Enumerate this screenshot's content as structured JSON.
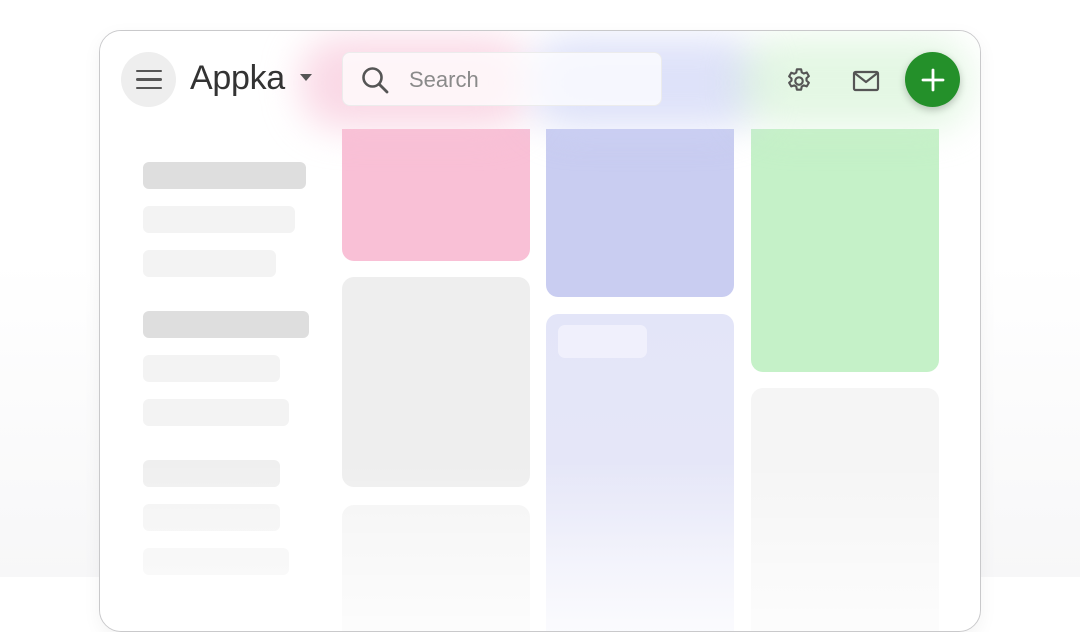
{
  "header": {
    "menu_icon": "hamburger-menu-icon",
    "app_name": "Appka",
    "app_switch_icon": "caret-down-icon",
    "search": {
      "placeholder": "Search",
      "icon": "search-icon"
    },
    "settings_icon": "gear-icon",
    "mail_icon": "mail-icon",
    "add_icon": "plus-icon"
  },
  "colors": {
    "accent": "#24902a",
    "card_pink": "#f9c0d6",
    "card_periwinkle": "#c9cdf1",
    "card_green": "#c5f1c8",
    "card_lavender": "#e3e5f8",
    "card_gray": "#eeeeee",
    "card_light_gray": "#f5f5f5",
    "skeleton_dark": "#dedede",
    "skeleton_light": "#f3f3f3"
  }
}
